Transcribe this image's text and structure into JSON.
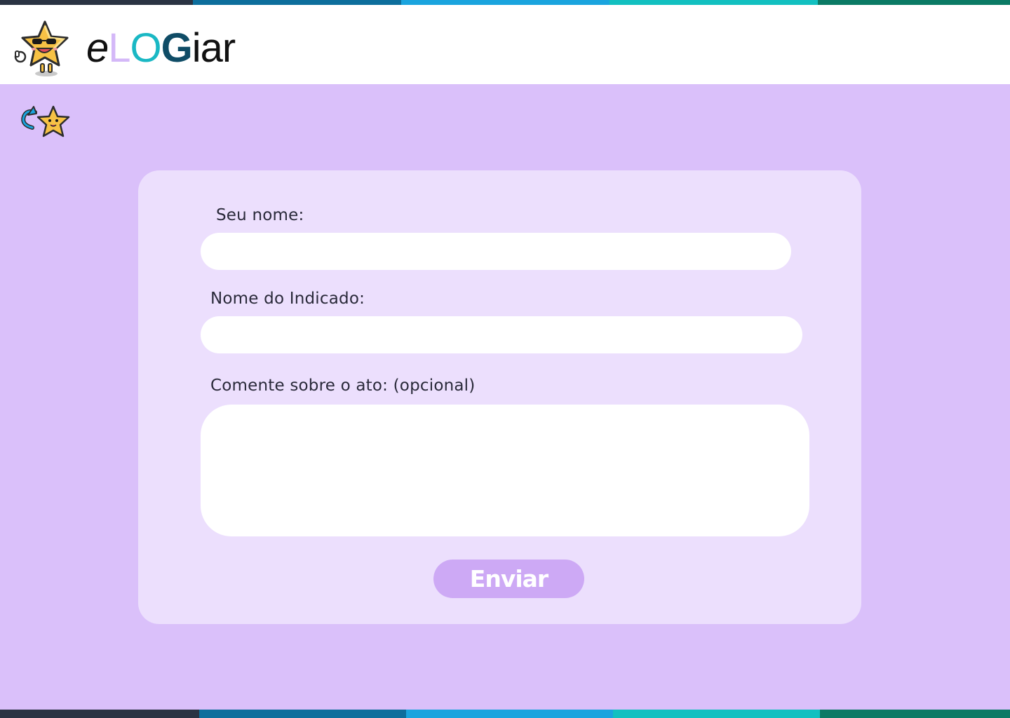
{
  "brand": {
    "e": "e",
    "l": "L",
    "o": "O",
    "g": "G",
    "rest": "iar"
  },
  "colors": {
    "page_bg": "#dac0fa",
    "card_bg": "#ecdffd",
    "button_bg": "#cda9f5",
    "stripe": [
      "#2a3343",
      "#0d6e9c",
      "#1aa4de",
      "#12c0c0",
      "#0b7a65"
    ]
  },
  "icons": {
    "logo": "star-mascot-sunglasses-icon",
    "back": "back-arrow-star-icon"
  },
  "form": {
    "name_label": "Seu nome:",
    "name_value": "",
    "nominee_label": "Nome do Indicado:",
    "nominee_value": "",
    "comment_label": "Comente sobre o ato: (opcional)",
    "comment_value": "",
    "submit_label": "Enviar"
  }
}
